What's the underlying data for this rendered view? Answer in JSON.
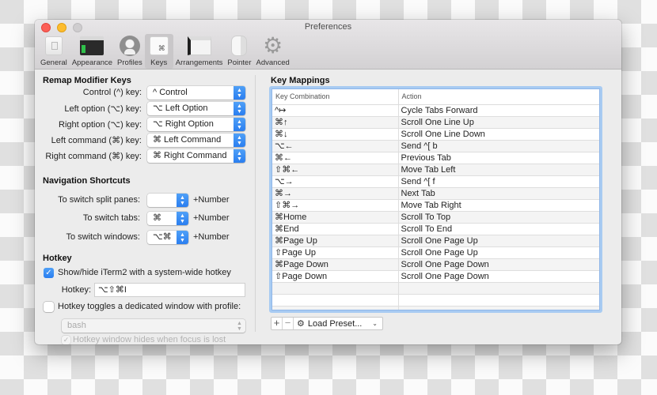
{
  "window": {
    "title": "Preferences",
    "traffic_lights": [
      "close",
      "minimize",
      "zoom"
    ]
  },
  "toolbar": {
    "items": [
      {
        "label": "General",
        "icon": "general-icon",
        "active": false
      },
      {
        "label": "Appearance",
        "icon": "appearance-icon",
        "active": false
      },
      {
        "label": "Profiles",
        "icon": "profiles-icon",
        "active": false
      },
      {
        "label": "Keys",
        "icon": "keys-icon",
        "active": true,
        "glyph": "⌘"
      },
      {
        "label": "Arrangements",
        "icon": "arrangements-icon",
        "active": false
      },
      {
        "label": "Pointer",
        "icon": "pointer-icon",
        "active": false
      },
      {
        "label": "Advanced",
        "icon": "gear-icon",
        "active": false,
        "glyph": "⚙"
      }
    ]
  },
  "remap": {
    "title": "Remap Modifier Keys",
    "rows": [
      {
        "label": "Control (^) key:",
        "value": "^ Control"
      },
      {
        "label": "Left option (⌥) key:",
        "value": "⌥ Left Option"
      },
      {
        "label": "Right option (⌥) key:",
        "value": "⌥ Right Option"
      },
      {
        "label": "Left command (⌘) key:",
        "value": "⌘ Left Command"
      },
      {
        "label": "Right command (⌘) key:",
        "value": "⌘ Right Command"
      }
    ]
  },
  "navigation": {
    "title": "Navigation Shortcuts",
    "rows": [
      {
        "label": "To switch split panes:",
        "value": "",
        "suffix": "+Number"
      },
      {
        "label": "To switch tabs:",
        "value": "⌘",
        "suffix": "+Number"
      },
      {
        "label": "To switch windows:",
        "value": "⌥⌘",
        "suffix": "+Number"
      }
    ]
  },
  "hotkey": {
    "title": "Hotkey",
    "show_hide_label": "Show/hide iTerm2 with a system-wide hotkey",
    "show_hide_checked": true,
    "hotkey_label": "Hotkey:",
    "hotkey_value": "⌥⇧⌘I",
    "dedicated_label": "Hotkey toggles a dedicated window with profile:",
    "dedicated_checked": false,
    "profile_value": "bash",
    "hides_label": "Hotkey window hides when focus is lost",
    "hides_checked": true
  },
  "key_mappings": {
    "title": "Key Mappings",
    "columns": [
      "Key Combination",
      "Action"
    ],
    "rows": [
      [
        "^↦",
        "Cycle Tabs Forward"
      ],
      [
        "⌘↑",
        "Scroll One Line Up"
      ],
      [
        "⌘↓",
        "Scroll One Line Down"
      ],
      [
        "⌥←",
        "Send ^[ b"
      ],
      [
        "⌘←",
        "Previous Tab"
      ],
      [
        "⇧⌘←",
        "Move Tab Left"
      ],
      [
        "⌥→",
        "Send ^[ f"
      ],
      [
        "⌘→",
        "Next Tab"
      ],
      [
        "⇧⌘→",
        "Move Tab Right"
      ],
      [
        "⌘Home",
        "Scroll To Top"
      ],
      [
        "⌘End",
        "Scroll To End"
      ],
      [
        "⌘Page Up",
        "Scroll One Page Up"
      ],
      [
        "⇧Page Up",
        "Scroll One Page Up"
      ],
      [
        "⌘Page Down",
        "Scroll One Page Down"
      ],
      [
        "⇧Page Down",
        "Scroll One Page Down"
      ]
    ],
    "empty_rows": 3,
    "add_label": "+",
    "remove_label": "−",
    "load_preset_label": "Load Preset...",
    "chevron": "⌄"
  },
  "colors": {
    "accent": "#2a7ef0",
    "focus_ring": "#a8cbf2",
    "close": "#fc5f57",
    "minimize": "#fdbc2e",
    "zoom": "#cfcdcf"
  }
}
